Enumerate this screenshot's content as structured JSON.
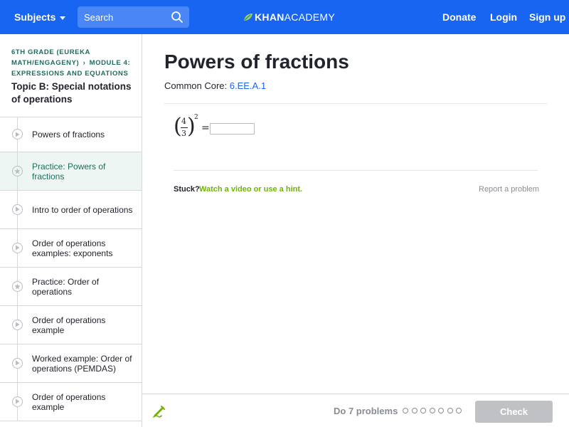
{
  "topbar": {
    "subjects_label": "Subjects",
    "search_placeholder": "Search",
    "logo_khan": "KHAN",
    "logo_academy": "ACADEMY",
    "donate_label": "Donate",
    "login_label": "Login",
    "signup_label": "Sign up",
    "bar_color": "#1865f2"
  },
  "sidebar": {
    "crumb_course": "6th grade (Eureka Math/EngageNY)",
    "crumb_module": "Module 4: Expressions and equations",
    "topic_title": "Topic B: Special notations of operations",
    "items": [
      {
        "label": "Powers of fractions",
        "icon": "play-icon"
      },
      {
        "label": "Practice: Powers of fractions",
        "icon": "star-icon"
      },
      {
        "label": "Intro to order of operations",
        "icon": "play-icon"
      },
      {
        "label": "Order of operations examples: exponents",
        "icon": "play-icon"
      },
      {
        "label": "Practice: Order of operations",
        "icon": "star-icon"
      },
      {
        "label": "Order of operations example",
        "icon": "play-icon"
      },
      {
        "label": "Worked example: Order of operations (PEMDAS)",
        "icon": "play-icon"
      },
      {
        "label": "Order of operations example",
        "icon": "play-icon"
      }
    ]
  },
  "main": {
    "title": "Powers of fractions",
    "common_core_prefix": "Common Core: ",
    "common_core_code": "6.EE.A.1",
    "problem": {
      "open_paren": "(",
      "numerator": "4",
      "denominator": "3",
      "close_paren": ")",
      "exponent": "2",
      "equals": "=",
      "answer_value": ""
    },
    "stuck_label": "Stuck?",
    "hint_label": "Watch a video or use a hint.",
    "report_label": "Report a problem"
  },
  "footer": {
    "do_problems": "Do 7 problems",
    "dot_count": 7,
    "check_label": "Check"
  },
  "colors": {
    "accent": "#1865f2",
    "hint_green": "#71b307",
    "crumb_green": "#1f6c5c",
    "disabled_gray": "#bfc1c4"
  }
}
